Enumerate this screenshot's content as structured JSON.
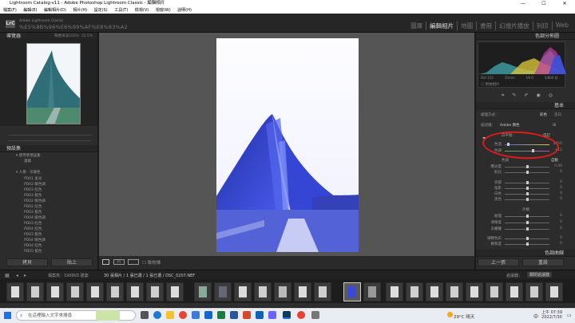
{
  "window": {
    "title": "Lightroom Catalog-v11 - Adobe Photoshop Lightroom Classic - 編輯相片",
    "minimize": "—",
    "maximize": "☐",
    "close": "✕"
  },
  "menu": [
    "檔案(F)",
    "編輯(E)",
    "編輯相片(D)",
    "相片(H)",
    "設定(S)",
    "工具(T)",
    "檢視(V)",
    "視窗(W)",
    "說明(H)"
  ],
  "identity": {
    "logo": "LrC",
    "subtitle": "Adobe Lightroom Classic",
    "catalog_name": "%E5%8B%96%E6%99%AF%E8%83%A2"
  },
  "modules": [
    "圖庫",
    "編輯相片",
    "地圖",
    "書冊",
    "幻燈片播放",
    "列印",
    "Web"
  ],
  "active_module": "編輯相片",
  "left": {
    "navigator_title": "導覽器",
    "zoom_options": [
      "符合",
      "填滿",
      "100%",
      "22.5%"
    ],
    "presets_title": "預設集",
    "preset_groups": [
      {
        "name": "使用者預設集",
        "items": [
          "濾鏡"
        ]
      },
      {
        "name": "人像 : 深膚色",
        "items": [
          "PD01 柔光",
          "PD02 暖色調",
          "PD03 紅色",
          "PD03 藍色",
          "PD02 暖色調",
          "PD02 紅色",
          "PD03 藍色",
          "PD04 暖色調",
          "PD03 紅色",
          "PD04 紅色",
          "PD03 藍色",
          "PD04 暖色調",
          "PD04 紅色",
          "PD05 藍色"
        ]
      }
    ],
    "import_label": "拷貝",
    "export_label": "貼上"
  },
  "toolbar": {
    "view_label": "YY",
    "soft_proof_label": "軟校樣"
  },
  "right": {
    "histogram_title": "色調分佈圖",
    "histogram_readout": [
      "ISO 125",
      "35mm",
      "f/8.0",
      "1/800 秒"
    ],
    "original_photo": "原始相片",
    "basic_title": "基本",
    "treatment_label": "處理方式：",
    "treatment_options": [
      "彩色",
      "黑白"
    ],
    "profile_label": "描述檔：",
    "profile_value": "Adobe 顏色",
    "wb_label": "白平衡：",
    "wb_value": "自訂",
    "sliders": [
      {
        "label": "色溫",
        "value": "4950",
        "pos": 0.48
      },
      {
        "label": "色調",
        "value": "+15",
        "pos": 0.52
      },
      {
        "label": "色調",
        "value": "",
        "pos": 0.0
      },
      {
        "label": "曝光度",
        "value": "0.00",
        "pos": 0.5
      },
      {
        "label": "對比",
        "value": "0",
        "pos": 0.5
      },
      {
        "label": "亮部",
        "value": "0",
        "pos": 0.5
      },
      {
        "label": "陰影",
        "value": "0",
        "pos": 0.5
      },
      {
        "label": "白色",
        "value": "0",
        "pos": 0.5
      },
      {
        "label": "黑色",
        "value": "0",
        "pos": 0.5
      },
      {
        "label": "紋理",
        "value": "0",
        "pos": 0.5
      },
      {
        "label": "清晰度",
        "value": "0",
        "pos": 0.5
      },
      {
        "label": "去朦朧",
        "value": "0",
        "pos": 0.5
      },
      {
        "label": "細節色彩",
        "value": "0",
        "pos": 0.5
      },
      {
        "label": "飽和度",
        "value": "0",
        "pos": 0.5
      }
    ],
    "auto_label": "自動",
    "presence_label": "外觀",
    "tone_curve_title": "色調曲線",
    "prev_label": "上一張",
    "reset_label": "重設"
  },
  "filmbar": {
    "info": "檔案夾：190903 建築",
    "count": "30 張相片 / 1 張已選 / 1 張已選 / DSC_0207.NEF",
    "filter_label": "過濾器：",
    "filter_value": "關閉過濾器"
  },
  "taskbar": {
    "search_placeholder": "在這裡輸入文字來搜尋",
    "weather": "29°C 晴天",
    "ime": "中",
    "time": "上午 07:39",
    "date": "2022/7/30"
  },
  "colors": {
    "accent": "#e01b1b",
    "photo_blue": "#3a49d9"
  }
}
